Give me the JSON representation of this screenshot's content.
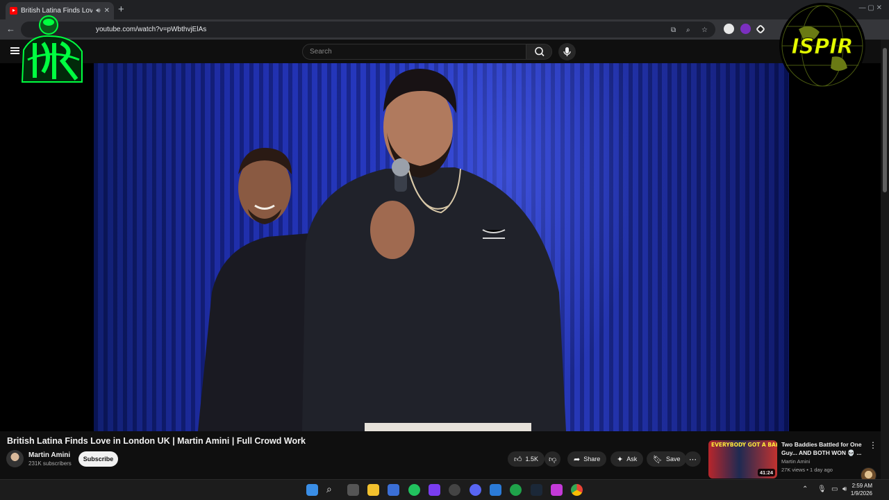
{
  "browser": {
    "tab_title": "British Latina Finds Love in London",
    "tab_audio_icon": "speaker-icon",
    "tab_close": "✕",
    "new_tab": "+",
    "url": "youtube.com/watch?v=pWbthvjElAs",
    "window_controls": "—   ▢   ✕"
  },
  "youtube": {
    "search_placeholder": "Search"
  },
  "video": {
    "title": "British Latina Finds Love in London UK | Martin Amini | Full Crowd Work",
    "channel_name": "Martin Amini",
    "subscribers": "231K subscribers",
    "subscribe_label": "Subscribe",
    "likes": "1.5K",
    "share_label": "Share",
    "ask_label": "Ask",
    "save_label": "Save"
  },
  "recommendation": {
    "thumb_caption": "EVERYBODY GOT A BADDIE",
    "duration": "41:24",
    "title": "Two Baddies Battled for One Guy... AND BOTH WON 💀 ...",
    "channel": "Martin Amini",
    "meta": "27K views • 1 day ago"
  },
  "overlays": {
    "right_logo_text": "ISPIR"
  },
  "taskbar": {
    "time": "2:59 AM",
    "date": "1/9/2026"
  },
  "colors": {
    "youtube_red": "#ff0000",
    "background": "#0f0f0f",
    "stage_blue": "#2437c4",
    "logo_green": "#00ff40",
    "logo_yellow": "#e5ff00"
  }
}
